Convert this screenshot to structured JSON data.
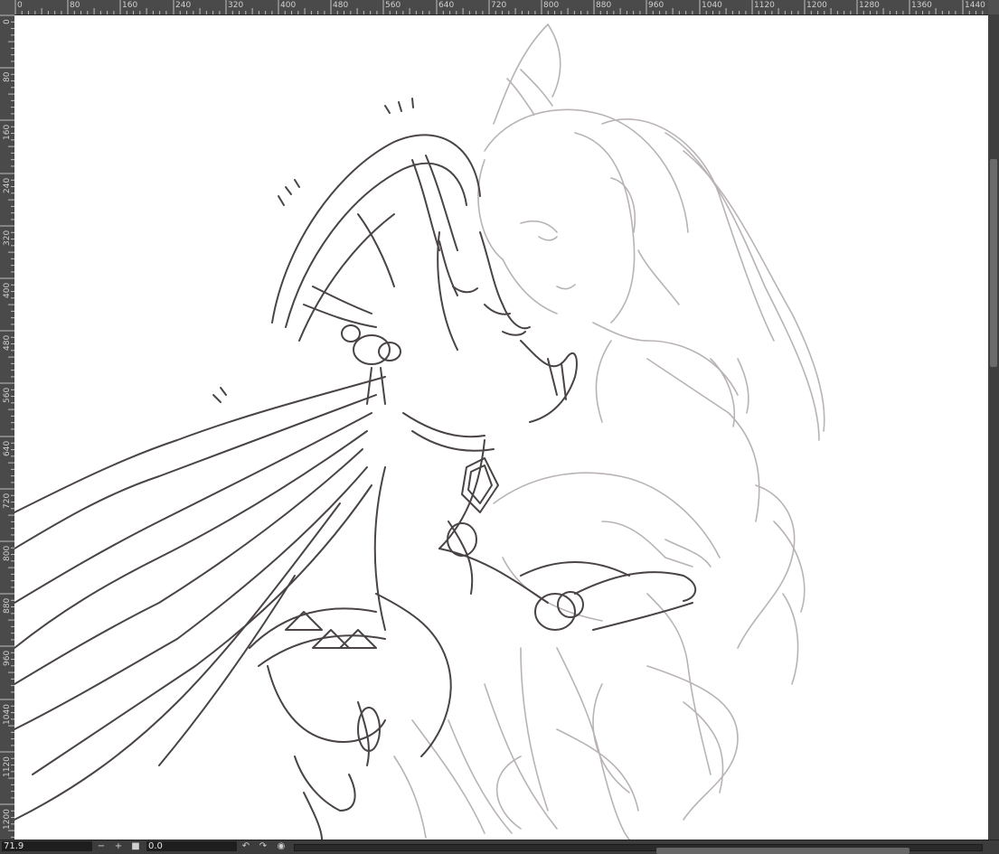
{
  "ruler": {
    "top_ticks": [
      "0",
      "80",
      "160",
      "240",
      "320",
      "400",
      "480",
      "560",
      "640",
      "720",
      "800",
      "880",
      "960",
      "1040",
      "1120",
      "1200",
      "1280",
      "1360",
      "1440"
    ],
    "left_ticks": [
      "0",
      "80",
      "160",
      "240",
      "320",
      "400",
      "480",
      "560",
      "640",
      "720",
      "800",
      "880",
      "960",
      "1040",
      "1120",
      "1200"
    ]
  },
  "canvas": {
    "content": "line-art sketch of two figures"
  },
  "status": {
    "zoom_value": "71.9",
    "rotation_value": "0.0",
    "zoom_out_icon": "minus-icon",
    "zoom_in_icon": "plus-icon",
    "fit_icon": "square-icon",
    "rotate_left_icon": "rotate-left-icon",
    "rotate_right_icon": "rotate-right-icon",
    "reset_rotation_icon": "reset-icon"
  }
}
